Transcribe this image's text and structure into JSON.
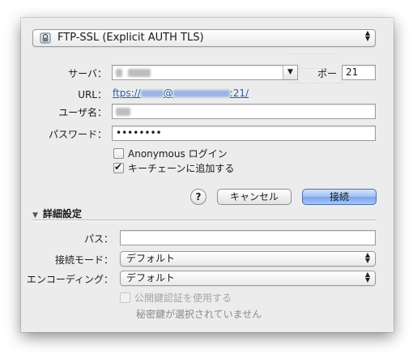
{
  "protocol": {
    "selected": "FTP-SSL (Explicit AUTH TLS)"
  },
  "server": {
    "label": "サーバ：",
    "value": ""
  },
  "port": {
    "label": "ポー",
    "value": "21"
  },
  "url": {
    "label": "URL：",
    "prefix": "ftps://",
    "at": "@",
    "suffix": ":21/"
  },
  "username": {
    "label": "ユーザ名：",
    "value": ""
  },
  "password": {
    "label": "パスワード：",
    "value": "••••••••"
  },
  "anonymous": {
    "label": "Anonymous ログイン",
    "checked": false
  },
  "keychain": {
    "label": "キーチェーンに追加する",
    "checked": true
  },
  "buttons": {
    "help": "?",
    "cancel": "キャンセル",
    "connect": "接続"
  },
  "advanced": {
    "title": "詳細設定",
    "path": {
      "label": "パス：",
      "value": ""
    },
    "connect_mode": {
      "label": "接続モード：",
      "value": "デフォルト"
    },
    "encoding": {
      "label": "エンコーディング：",
      "value": "デフォルト"
    },
    "public_key": {
      "label": "公開鍵認証を使用する",
      "checked": false,
      "enabled": false
    },
    "private_key_status": "秘密鍵が選択されていません"
  },
  "colors": {
    "link": "#2a5db0",
    "default_button": "#79a5ec",
    "sheet_bg": "#ececec"
  }
}
